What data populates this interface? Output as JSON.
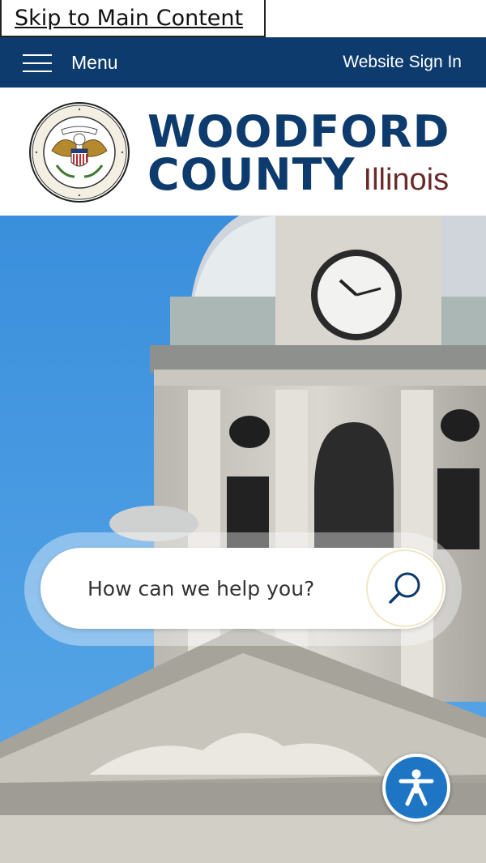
{
  "skip_link": {
    "label": "Skip to Main Content"
  },
  "header": {
    "menu_label": "Menu",
    "signin_label": "Website Sign In",
    "color": "#0e3b6e"
  },
  "brand": {
    "name_line1": "WOODFORD",
    "name_line2": "COUNTY",
    "state": "Illinois",
    "seal_icon": "county-seal-eagle"
  },
  "search": {
    "placeholder": "How can we help you?",
    "icon": "search-icon"
  },
  "accessibility": {
    "icon": "accessibility-person-icon",
    "color": "#1d75c4"
  }
}
